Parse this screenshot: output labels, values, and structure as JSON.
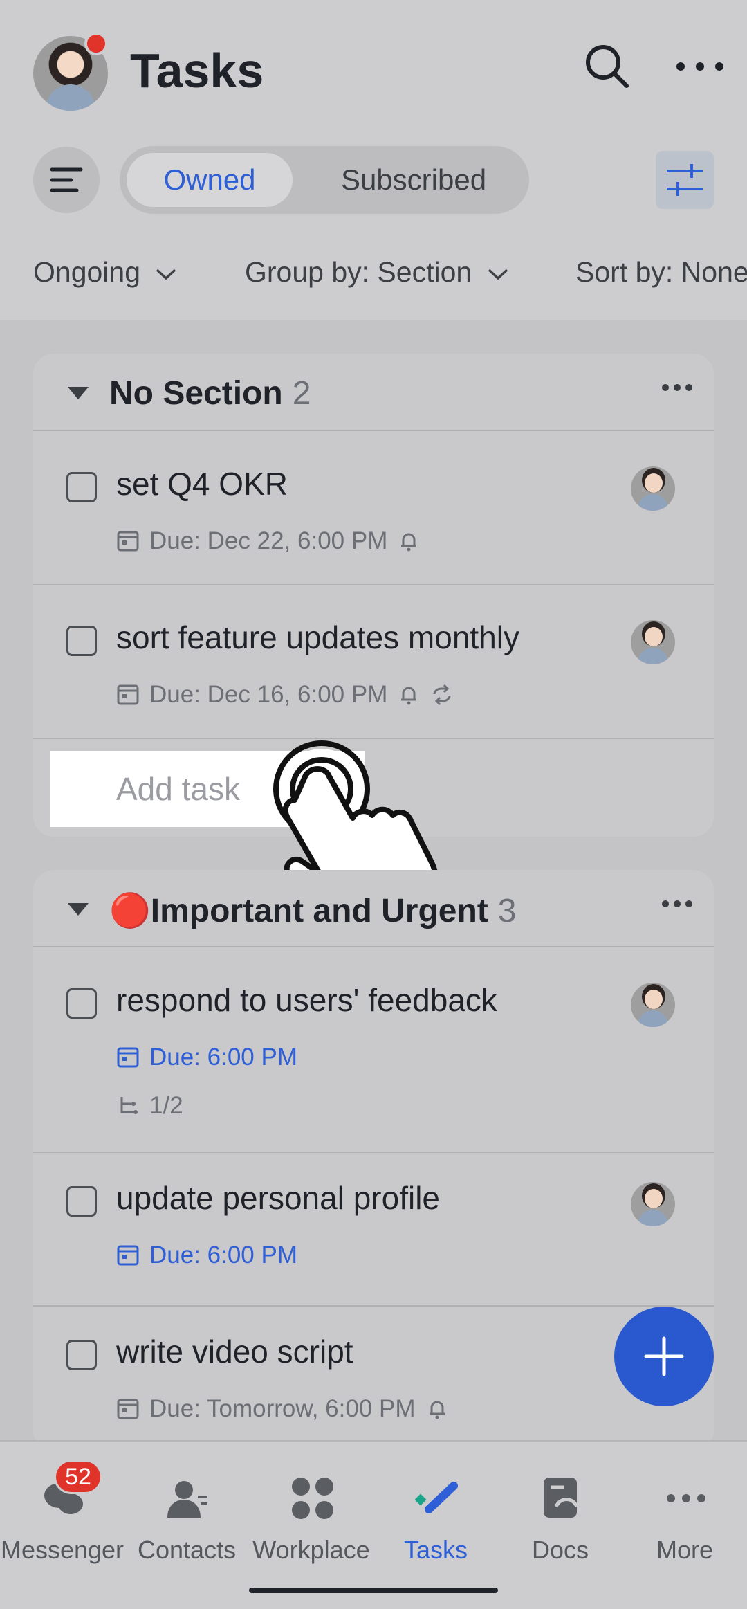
{
  "header": {
    "title": "Tasks",
    "tabs": [
      {
        "label": "Owned",
        "selected": true
      },
      {
        "label": "Subscribed",
        "selected": false
      }
    ],
    "icons": [
      "menu-icon",
      "search-icon",
      "more-icon",
      "filter-settings-icon"
    ]
  },
  "filters": {
    "status": "Ongoing",
    "group_by": "Group by: Section",
    "sort_by": "Sort by: None"
  },
  "sections": [
    {
      "name": "No Section",
      "count": "2",
      "tasks": [
        {
          "title": "set Q4 OKR",
          "due": "Due: Dec 22, 6:00 PM",
          "reminder": true
        },
        {
          "title": "sort feature updates monthly",
          "due": "Due: Dec 16, 6:00 PM",
          "reminder": true,
          "repeat": true
        }
      ],
      "add_label": "Add task"
    },
    {
      "name": "🔴Important and Urgent",
      "count": "3",
      "tasks": [
        {
          "title": "respond to users' feedback",
          "due": "Due: 6:00 PM",
          "subtasks": "1/2",
          "due_highlight": true
        },
        {
          "title": "update personal profile",
          "due": "Due: 6:00 PM",
          "due_highlight": true
        },
        {
          "title": "write video script",
          "due": "Due: Tomorrow, 6:00 PM",
          "reminder": true
        }
      ]
    }
  ],
  "bottom_nav": [
    {
      "label": "Messenger",
      "badge": "52"
    },
    {
      "label": "Contacts"
    },
    {
      "label": "Workplace"
    },
    {
      "label": "Tasks",
      "active": true
    },
    {
      "label": "Docs"
    },
    {
      "label": "More"
    }
  ],
  "colors": {
    "accent": "#2f5fd6",
    "badge": "#e0342b",
    "fab": "#2a58cf"
  }
}
